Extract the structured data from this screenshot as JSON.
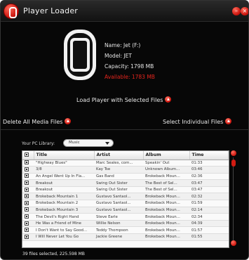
{
  "window": {
    "title": "Player Loader"
  },
  "device": {
    "name": "Name: Jet (F:)",
    "model": "Model: JET",
    "capacity": "Capacity: 1798 MB",
    "available": "Available: 1783 MB"
  },
  "actions": {
    "load": "Load Player with Selected Files",
    "delete_all": "Delete All Media Files",
    "select_individual": "Select Individual Files"
  },
  "library": {
    "label": "Your PC Library:",
    "selected": "Music"
  },
  "table": {
    "headers": [
      "Title",
      "Artist",
      "Album",
      "Time"
    ],
    "rows": [
      [
        "\"Highway Blues\"",
        "Marc Seales, com...",
        "Speakin' Out",
        "01:33"
      ],
      [
        "3/8",
        "Kay Tse",
        "Unknown Album...",
        "03:46"
      ],
      [
        "An Angel Went Up In Fla...",
        "Gas Band",
        "Brokeback Moun...",
        "02:36"
      ],
      [
        "Breakout",
        "Swing Out Sister",
        "The Best of Sel...",
        "03:47"
      ],
      [
        "Breakout",
        "Swing Out Sister",
        "The Best of Sel...",
        "03:47"
      ],
      [
        "Brokeback Mountain 1",
        "Gustavo Santaol...",
        "Brokeback Moun...",
        "02:32"
      ],
      [
        "Brokeback Mountain 2",
        "Gustavo Santaol...",
        "Brokeback Moun...",
        "01:59"
      ],
      [
        "Brokeback Mountain 3",
        "Gustavo Santaol...",
        "Brokeback Moun...",
        "02:14"
      ],
      [
        "The Devil's Right Hand",
        "Steve Earle",
        "Brokeback Moun...",
        "02:34"
      ],
      [
        "He Was a Friend of Mine",
        "Willie Nelson",
        "Brokeback Moun...",
        "04:39"
      ],
      [
        "I Don't Want to Say Good...",
        "Teddy Thompson",
        "Brokeback Moun...",
        "01:57"
      ],
      [
        "I Will Never Let You Go",
        "Jackie Greene",
        "Brokeback Moun...",
        "01:55"
      ]
    ]
  },
  "status": "39 files selected, 225.598 MB",
  "colors": {
    "accent": "#d21b12",
    "background": "#070707"
  }
}
